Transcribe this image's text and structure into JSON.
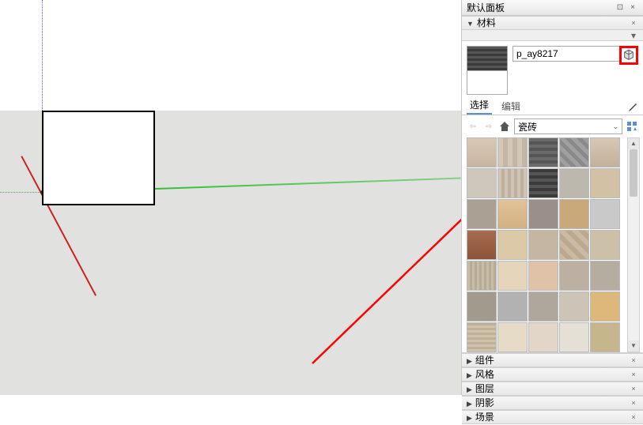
{
  "panel": {
    "title": "默认面板",
    "sections": {
      "materials": {
        "title": "材料",
        "expanded": true
      },
      "components": {
        "title": "组件"
      },
      "styles": {
        "title": "风格"
      },
      "layers": {
        "title": "图层"
      },
      "shadows": {
        "title": "阴影"
      },
      "scenes": {
        "title": "场景"
      }
    }
  },
  "material": {
    "name": "p_ay8217",
    "tabs": {
      "select": "选择",
      "edit": "编辑"
    },
    "category": "瓷砖"
  },
  "icons": {
    "back": "⇦",
    "forward": "⇨",
    "chev_down": "⌄",
    "close": "×",
    "pin": "⊡",
    "up": "▲",
    "down": "▼",
    "menu": "▾",
    "tri_right": "▶",
    "tri_down": "▼"
  }
}
